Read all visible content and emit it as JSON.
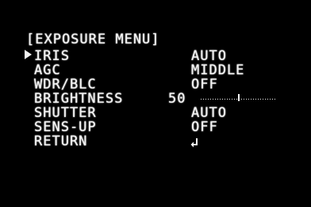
{
  "menu": {
    "title": "[EXPOSURE MENU]",
    "selected_item": "IRIS",
    "items": [
      {
        "label": "IRIS",
        "value": "AUTO"
      },
      {
        "label": "AGC",
        "value": "MIDDLE"
      },
      {
        "label": "WDR/BLC",
        "value": "OFF"
      },
      {
        "label": "BRIGHTNESS",
        "value": "50",
        "level": 0.5
      },
      {
        "label": "SHUTTER",
        "value": "AUTO"
      },
      {
        "label": "SENS-UP",
        "value": "OFF"
      },
      {
        "label": "RETURN",
        "icon": "return-arrow-icon"
      }
    ]
  },
  "colors": {
    "text": "#f4f4f4",
    "background": "#000000"
  }
}
